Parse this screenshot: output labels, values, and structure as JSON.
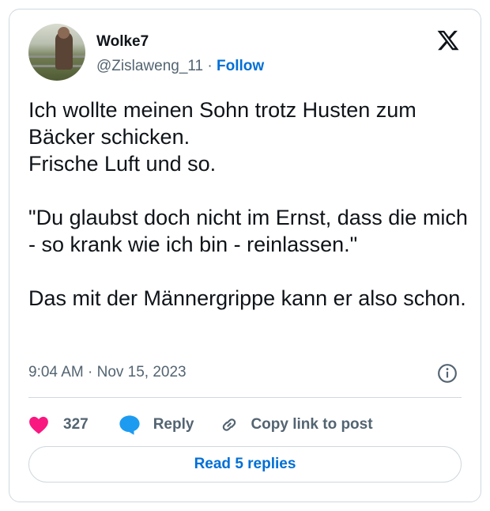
{
  "author": {
    "display_name": "Wolke7",
    "handle": "@Zislaweng_11",
    "separator": "·",
    "follow_label": "Follow"
  },
  "tweet": {
    "text": "Ich wollte meinen Sohn trotz Husten zum Bäcker schicken.\nFrische Luft und so.\n\n\"Du glaubst doch nicht im Ernst, dass die mich - so krank wie ich bin - reinlassen.\"\n\nDas mit der Männergrippe kann er also schon.",
    "timestamp": "9:04 AM · Nov 15, 2023"
  },
  "actions": {
    "like_count": "327",
    "reply_label": "Reply",
    "copy_link_label": "Copy link to post"
  },
  "read_replies_label": "Read 5 replies",
  "icons": {
    "logo": "x-logo-icon",
    "info": "info-icon",
    "like": "heart-icon",
    "reply": "speech-bubble-icon",
    "copy": "link-icon"
  },
  "colors": {
    "accent": "#006fd6",
    "like": "#f91880",
    "reply": "#1d9bf0",
    "secondary_text": "#536471",
    "border": "#cfd9de"
  }
}
